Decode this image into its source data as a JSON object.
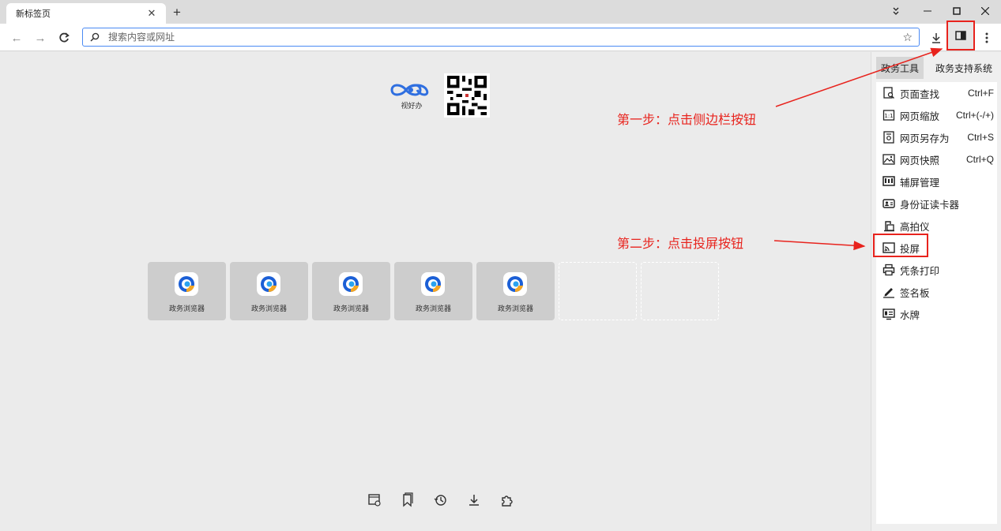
{
  "browser": {
    "tab_title": "新标签页",
    "omnibox_placeholder": "搜索内容或网址"
  },
  "newtab": {
    "logo_text": "视好办",
    "tiles": [
      {
        "label": "政务浏览器"
      },
      {
        "label": "政务浏览器"
      },
      {
        "label": "政务浏览器"
      },
      {
        "label": "政务浏览器"
      },
      {
        "label": "政务浏览器"
      }
    ]
  },
  "sidebar": {
    "tabs": [
      "政务工具",
      "政务支持系统"
    ],
    "items": [
      {
        "label": "页面查找",
        "shortcut": "Ctrl+F",
        "icon": "page-find-icon"
      },
      {
        "label": "网页缩放",
        "shortcut": "Ctrl+(-/+)",
        "icon": "zoom-icon"
      },
      {
        "label": "网页另存为",
        "shortcut": "Ctrl+S",
        "icon": "save-as-icon"
      },
      {
        "label": "网页快照",
        "shortcut": "Ctrl+Q",
        "icon": "snapshot-icon"
      },
      {
        "label": "辅屏管理",
        "shortcut": "",
        "icon": "secondary-screen-icon"
      },
      {
        "label": "身份证读卡器",
        "shortcut": "",
        "icon": "id-card-reader-icon"
      },
      {
        "label": "高拍仪",
        "shortcut": "",
        "icon": "document-camera-icon"
      },
      {
        "label": "投屏",
        "shortcut": "",
        "icon": "cast-screen-icon"
      },
      {
        "label": "凭条打印",
        "shortcut": "",
        "icon": "printer-icon"
      },
      {
        "label": "签名板",
        "shortcut": "",
        "icon": "signature-pen-icon"
      },
      {
        "label": "水牌",
        "shortcut": "",
        "icon": "display-board-icon"
      }
    ]
  },
  "annotations": {
    "step1": "第一步：点击侧边栏按钮",
    "step2": "第二步：点击投屏按钮"
  },
  "colors": {
    "annotation": "#e8231d",
    "omnibox_focus": "#4a8af4"
  }
}
